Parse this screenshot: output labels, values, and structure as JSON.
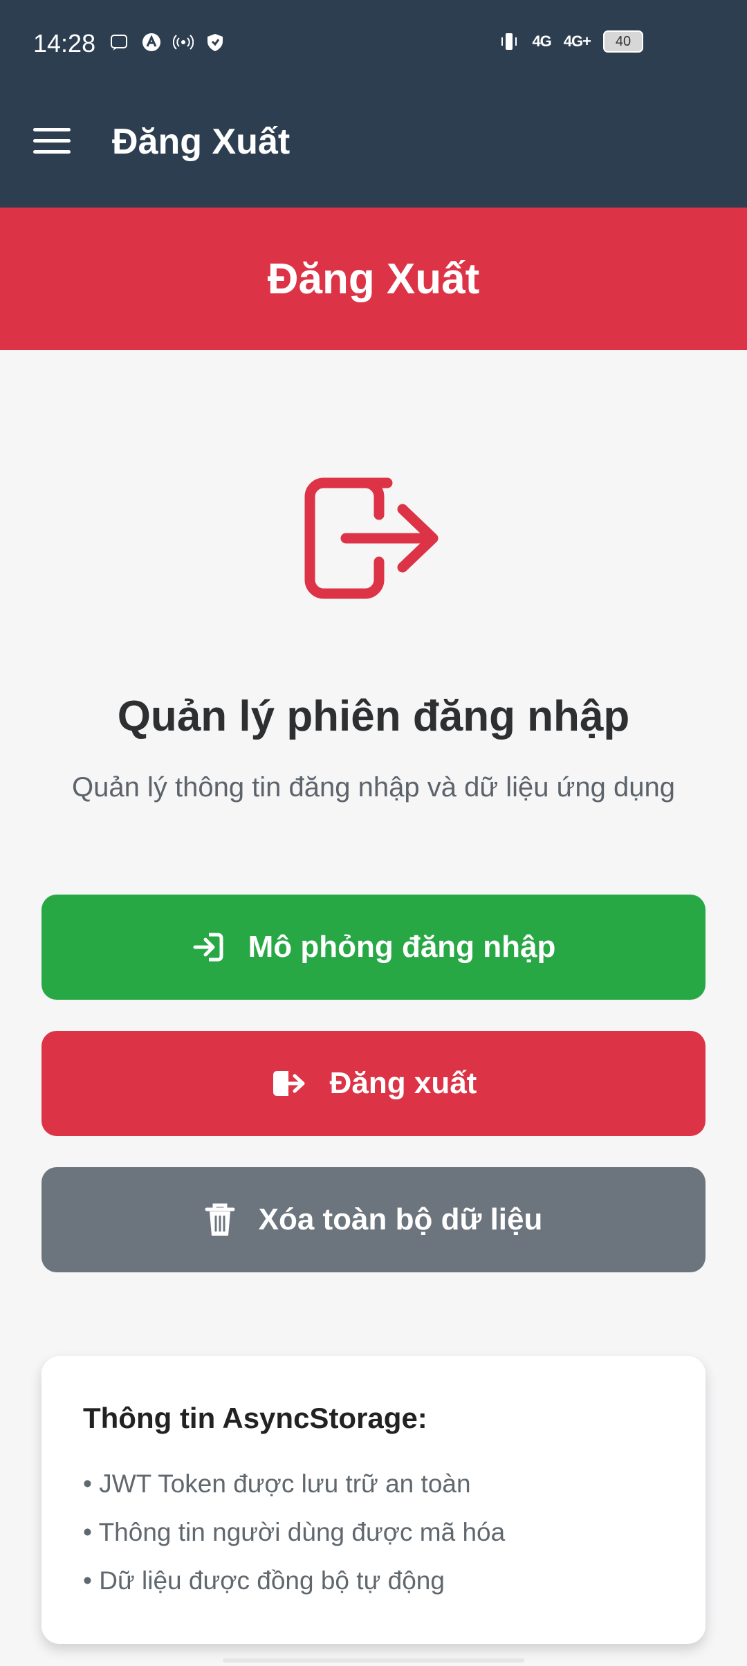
{
  "status_bar": {
    "time": "14:28",
    "network_1": "4G",
    "network_2": "4G+",
    "battery": "40"
  },
  "app_bar": {
    "title": "Đăng Xuất"
  },
  "banner": {
    "title": "Đăng Xuất"
  },
  "main": {
    "heading": "Quản lý phiên đăng nhập",
    "subheading": "Quản lý thông tin đăng nhập và dữ liệu ứng dụng"
  },
  "buttons": {
    "simulate_login": "Mô phỏng đăng nhập",
    "logout": "Đăng xuất",
    "clear_data": "Xóa toàn bộ dữ liệu"
  },
  "info_card": {
    "title": "Thông tin AsyncStorage:",
    "items": [
      "• JWT Token được lưu trữ an toàn",
      "• Thông tin người dùng được mã hóa",
      "• Dữ liệu được đồng bộ tự động"
    ]
  },
  "colors": {
    "header": "#2d3e50",
    "danger": "#dc3446",
    "success": "#27a844",
    "secondary": "#6c757d"
  },
  "icons": {
    "hero": "logout-icon",
    "simulate_login": "login-icon",
    "logout": "logout-icon",
    "clear_data": "trash-icon"
  }
}
